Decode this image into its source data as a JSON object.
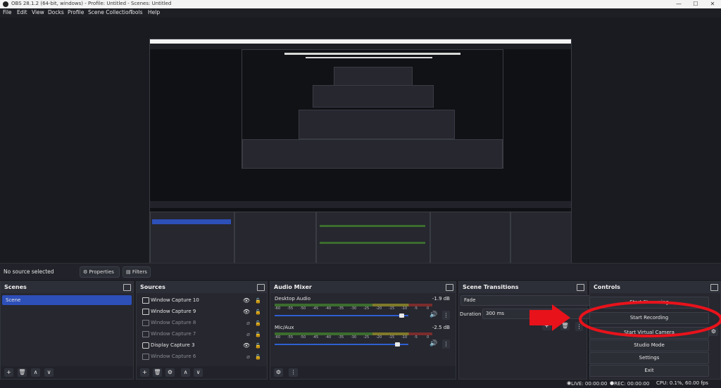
{
  "window": {
    "title": "OBS 28.1.2 (64-bit, windows) - Profile: Untitled - Scenes: Untitled",
    "minimize": "—",
    "maximize": "☐",
    "close": "✕"
  },
  "menu": [
    "File",
    "Edit",
    "View",
    "Docks",
    "Profile",
    "Scene Collection",
    "Tools",
    "Help"
  ],
  "context_bar": {
    "no_source": "No source selected",
    "properties": "Properties",
    "filters": "Filters"
  },
  "scenes": {
    "title": "Scenes",
    "items": [
      "Scene"
    ]
  },
  "sources": {
    "title": "Sources",
    "items": [
      {
        "label": "Window Capture 10",
        "visible": true
      },
      {
        "label": "Window Capture 9",
        "visible": true
      },
      {
        "label": "Window Capture 8",
        "visible": false
      },
      {
        "label": "Window Capture 7",
        "visible": false
      },
      {
        "label": "Display Capture 3",
        "visible": true
      },
      {
        "label": "Window Capture 6",
        "visible": false
      }
    ]
  },
  "mixer": {
    "title": "Audio Mixer",
    "channels": [
      {
        "name": "Desktop Audio",
        "db": "-1.9 dB",
        "volume": 0.95
      },
      {
        "name": "Mic/Aux",
        "db": "-2.5 dB",
        "volume": 0.92
      }
    ],
    "scale": [
      "-60",
      "-55",
      "-50",
      "-45",
      "-40",
      "-35",
      "-30",
      "-25",
      "-20",
      "-15",
      "-10",
      "-5",
      "0"
    ]
  },
  "transitions": {
    "title": "Scene Transitions",
    "selected": "Fade",
    "duration_label": "Duration",
    "duration_value": "300 ms"
  },
  "controls": {
    "title": "Controls",
    "buttons": [
      "Start Streaming",
      "Start Recording",
      "Start Virtual Camera",
      "Studio Mode",
      "Settings",
      "Exit"
    ]
  },
  "status": {
    "live": "LIVE: 00:00:00",
    "rec": "REC: 00:00:00",
    "cpu": "CPU: 0.1%, 60.00 fps"
  },
  "annotation_colors": {
    "arrow": "#e8121b",
    "ellipse": "#e8121b",
    "selection": "#2d4fb8"
  }
}
